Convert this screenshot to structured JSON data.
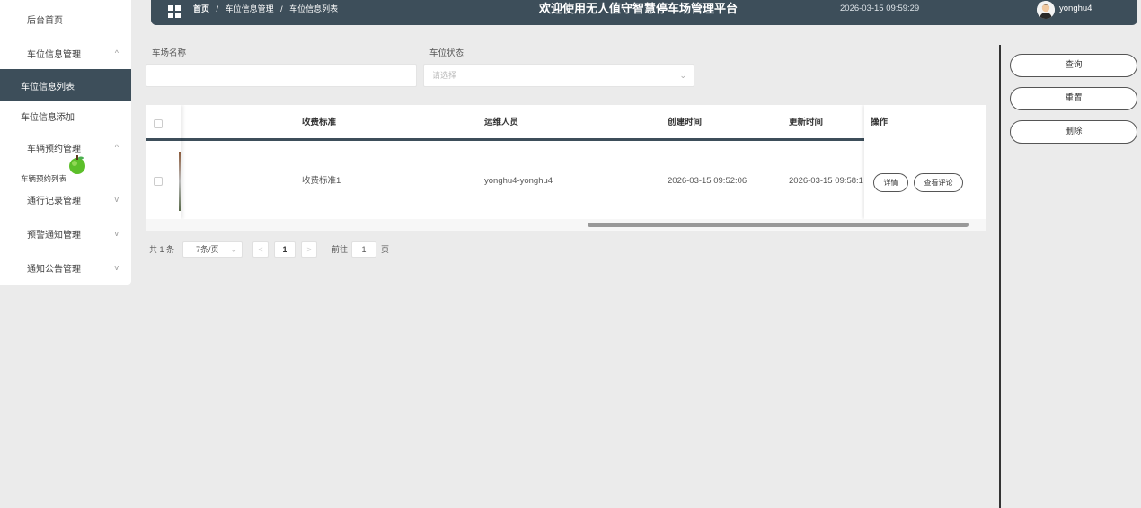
{
  "sidebar": {
    "items": [
      {
        "label": "后台首页",
        "arrow": ""
      },
      {
        "label": "车位信息管理",
        "arrow": "^"
      },
      {
        "label": "车位信息列表",
        "arrow": ""
      },
      {
        "label": "车位信息添加",
        "arrow": ""
      },
      {
        "label": "车辆预约管理",
        "arrow": "^"
      },
      {
        "label": "车辆预约列表",
        "arrow": ""
      },
      {
        "label": "通行记录管理",
        "arrow": "v"
      },
      {
        "label": "预警通知管理",
        "arrow": "v"
      },
      {
        "label": "通知公告管理",
        "arrow": "v"
      }
    ],
    "active_item": "车位信息列表"
  },
  "header": {
    "breadcrumb": [
      "首页",
      "车位信息管理",
      "车位信息列表"
    ],
    "separator": "/",
    "title": "欢迎使用无人值守智慧停车场管理平台",
    "datetime": "2026-03-15 09:59:29",
    "username": "yonghu4"
  },
  "filters": {
    "parking_name_label": "车场名称",
    "parking_name_value": "",
    "status_label": "车位状态",
    "status_placeholder": "请选择"
  },
  "table": {
    "headers": {
      "fee_standard": "收费标准",
      "operator": "运维人员",
      "created": "创建时间",
      "updated": "更新时间",
      "actions": "操作"
    },
    "rows": [
      {
        "fee_standard": "收费标准1",
        "operator": "yonghu4-yonghu4",
        "created": "2026-03-15 09:52:06",
        "updated": "2026-03-15 09:58:1",
        "detail_btn": "详情",
        "review_btn": "查看评论"
      }
    ]
  },
  "pagination": {
    "total": "共 1 条",
    "page_size": "7条/页",
    "prev": "<",
    "current": "1",
    "next": ">",
    "goto_label": "前往",
    "goto_value": "1",
    "page_unit": "页"
  },
  "actions": {
    "search": "查询",
    "reset": "重置",
    "delete": "删除"
  },
  "colors": {
    "primary": "#3d4e5a",
    "background": "#ebebeb"
  }
}
